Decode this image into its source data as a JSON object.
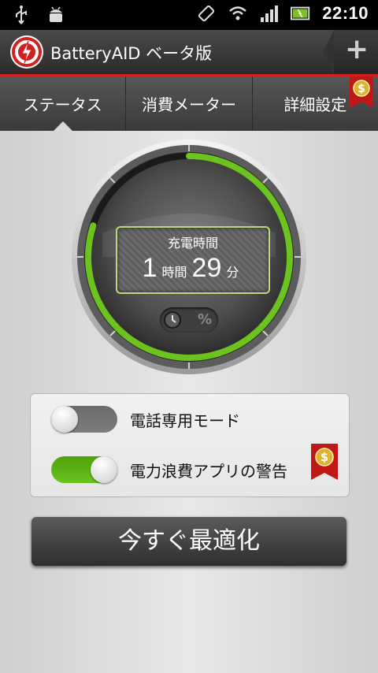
{
  "status_bar": {
    "time": "22:10",
    "icons": [
      "usb-icon",
      "android-debug-icon",
      "vibrate-icon",
      "wifi-icon",
      "signal-icon",
      "battery-charging-icon"
    ]
  },
  "app_bar": {
    "title": "BatteryAID ベータ版",
    "add_label": "+"
  },
  "tabs": [
    {
      "label": "ステータス",
      "active": true
    },
    {
      "label": "消費メーター",
      "active": false
    },
    {
      "label": "詳細設定",
      "active": false
    }
  ],
  "gauge": {
    "label": "充電時間",
    "hours": "1",
    "hours_unit": "時間",
    "minutes": "29",
    "minutes_unit": "分",
    "mode_percent_label": "%",
    "fill_fraction": 0.8
  },
  "settings": {
    "phone_mode_label": "電話専用モード",
    "phone_mode_on": false,
    "wasteful_apps_label": "電力浪費アプリの警告",
    "wasteful_apps_on": true
  },
  "optimize_button_label": "今すぐ最適化",
  "colors": {
    "accent_green": "#6cc21f",
    "brand_red": "#d21f1f",
    "gold": "#e0b12b"
  }
}
